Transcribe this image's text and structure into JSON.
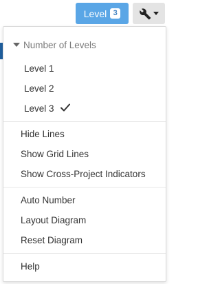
{
  "toolbar": {
    "level_label": "Level",
    "level_badge": "3",
    "tools_icon": "wrench-icon",
    "tools_caret": "caret-down-icon"
  },
  "menu": {
    "levels_header": "Number of Levels",
    "levels": [
      "Level 1",
      "Level 2",
      "Level 3"
    ],
    "selected_level": "Level 3",
    "display_items": [
      "Hide Lines",
      "Show Grid Lines",
      "Show Cross-Project Indicators"
    ],
    "layout_items": [
      "Auto Number",
      "Layout Diagram",
      "Reset Diagram"
    ],
    "help_label": "Help"
  },
  "colors": {
    "level_button_bg": "#5aa6e6",
    "tools_button_bg": "#e4e4e4",
    "text": "#333333",
    "header_text": "#7a7a7a"
  }
}
